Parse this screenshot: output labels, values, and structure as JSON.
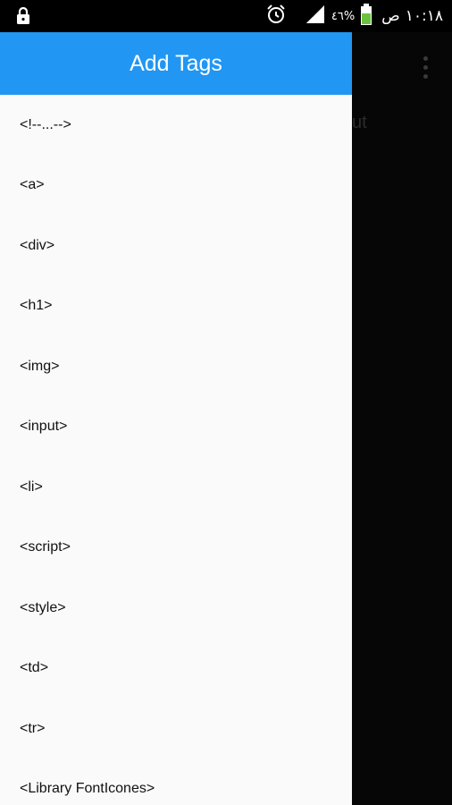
{
  "status_bar": {
    "time": "١٠:١٨",
    "am_pm": "ص",
    "battery_percent": "٤٦%",
    "icons": [
      "lock-icon",
      "alarm-icon",
      "signal-icon",
      "battery-icon"
    ]
  },
  "background": {
    "partial_text": "ut"
  },
  "drawer": {
    "title": "Add Tags",
    "items": [
      {
        "label": "<!--...-->"
      },
      {
        "label": "<a>"
      },
      {
        "label": "<div>"
      },
      {
        "label": "<h1>"
      },
      {
        "label": "<img>"
      },
      {
        "label": "<input>"
      },
      {
        "label": "<li>"
      },
      {
        "label": "<script>"
      },
      {
        "label": "<style>"
      },
      {
        "label": "<td>"
      },
      {
        "label": "<tr>"
      },
      {
        "label": "<Library FontIcones>"
      }
    ]
  },
  "colors": {
    "header": "#2196f3",
    "drawer_bg": "#fafafa",
    "status_bar": "#000000",
    "app_bg": "#060606"
  }
}
